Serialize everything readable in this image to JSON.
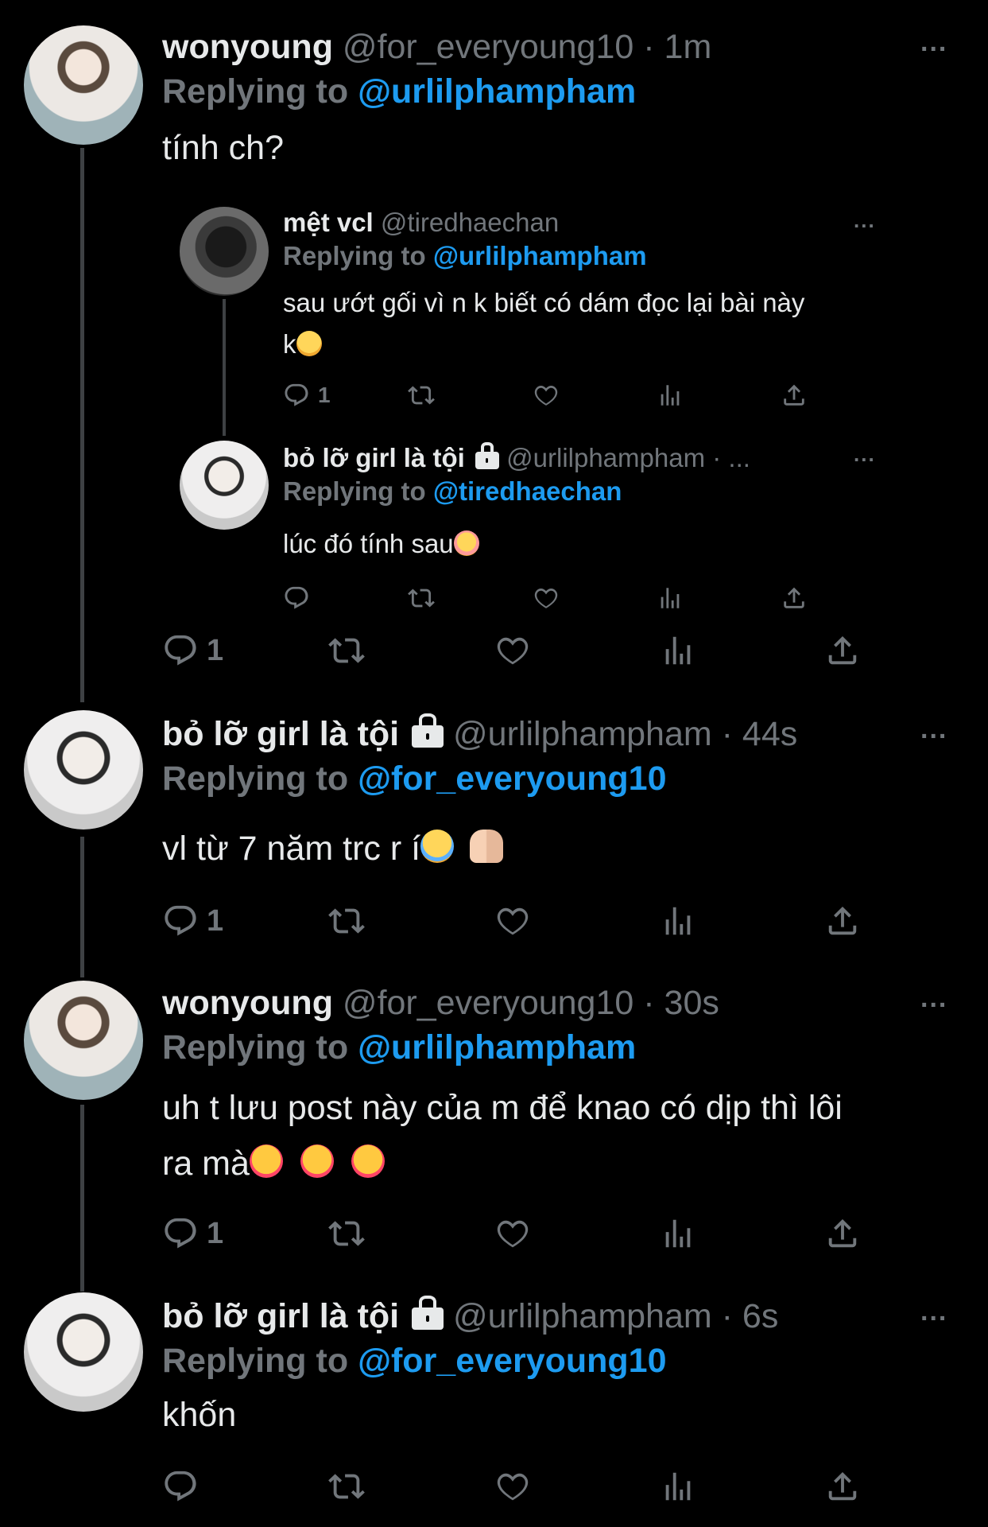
{
  "tweets": [
    {
      "name": "wonyoung",
      "handle": "@for_everyoung10",
      "time": "· 1m",
      "replying_label": "Replying to",
      "replying_to": "@urlilphampham",
      "text": "tính ch?",
      "reply_count": "1",
      "quoted": [
        {
          "name": "mệt vcl",
          "handle": "@tiredhaechan",
          "time": "",
          "replying_label": "Replying to",
          "replying_to": "@urlilphampham",
          "text_line1": "sau ướt gối vì n k biết có dám đọc lại bài này",
          "text_line2": "k",
          "reply_count": "1"
        },
        {
          "name": "bỏ lỡ girl là tội",
          "handle": "@urlilphampham · ...",
          "time": "",
          "replying_label": "Replying to",
          "replying_to": "@tiredhaechan",
          "text": "lúc đó tính sau",
          "reply_count": ""
        }
      ]
    },
    {
      "name": "bỏ lỡ girl là tội",
      "handle": "@urlilphampham",
      "time": "· 44s",
      "replying_label": "Replying to",
      "replying_to": "@for_everyoung10",
      "text": "vl từ 7 năm trc r í",
      "reply_count": "1"
    },
    {
      "name": "wonyoung",
      "handle": "@for_everyoung10",
      "time": "· 30s",
      "replying_label": "Replying to",
      "replying_to": "@urlilphampham",
      "text_line1": "uh t lưu post này của m để knao có dịp thì lôi",
      "text_line2": "ra mà",
      "reply_count": "1"
    },
    {
      "name": "bỏ lỡ girl là tội",
      "handle": "@urlilphampham",
      "time": "· 6s",
      "replying_label": "Replying to",
      "replying_to": "@for_everyoung10",
      "text": "khốn",
      "reply_count": ""
    }
  ],
  "more_icon": "...",
  "icons": [
    "reply-icon",
    "retweet-icon",
    "like-icon",
    "views-icon",
    "share-icon"
  ],
  "colors": {
    "background": "#000000",
    "text": "#e7e9ea",
    "muted": "#71767b",
    "link": "#1d9bf0",
    "line": "#3e4144"
  }
}
